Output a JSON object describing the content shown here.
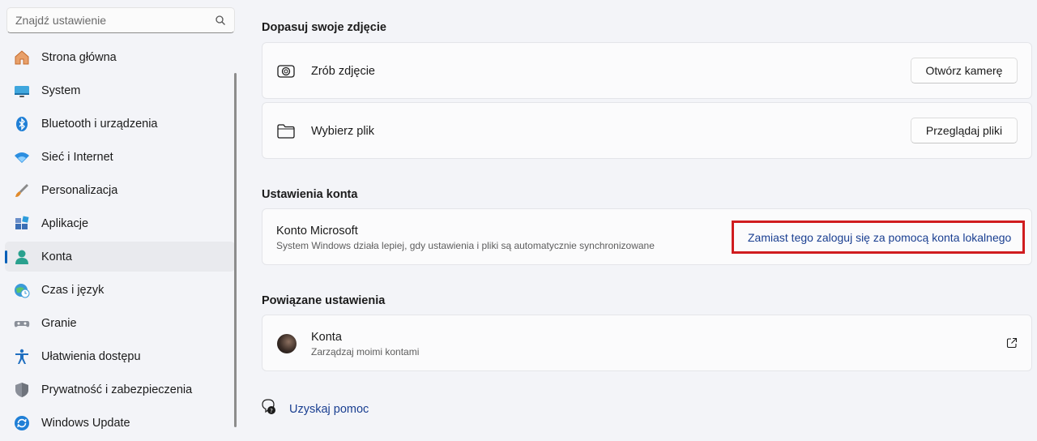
{
  "search": {
    "placeholder": "Znajdź ustawienie"
  },
  "sidebar": {
    "items": [
      {
        "label": "Strona główna",
        "icon": "home-icon"
      },
      {
        "label": "System",
        "icon": "system-monitor-icon"
      },
      {
        "label": "Bluetooth i urządzenia",
        "icon": "bluetooth-icon"
      },
      {
        "label": "Sieć i Internet",
        "icon": "wifi-icon"
      },
      {
        "label": "Personalizacja",
        "icon": "brush-icon"
      },
      {
        "label": "Aplikacje",
        "icon": "apps-icon"
      },
      {
        "label": "Konta",
        "icon": "account-icon",
        "active": true
      },
      {
        "label": "Czas i język",
        "icon": "globe-clock-icon"
      },
      {
        "label": "Granie",
        "icon": "gamepad-icon"
      },
      {
        "label": "Ułatwienia dostępu",
        "icon": "accessibility-icon"
      },
      {
        "label": "Prywatność i zabezpieczenia",
        "icon": "shield-icon"
      },
      {
        "label": "Windows Update",
        "icon": "update-icon"
      }
    ]
  },
  "photo": {
    "title": "Dopasuj swoje zdjęcie",
    "camera_label": "Zrób zdjęcie",
    "camera_button": "Otwórz kamerę",
    "file_label": "Wybierz plik",
    "file_button": "Przeglądaj pliki"
  },
  "account_settings": {
    "title": "Ustawienia konta",
    "account_title": "Konto Microsoft",
    "account_desc": "System Windows działa lepiej, gdy ustawienia i pliki są automatycznie synchronizowane",
    "local_link": "Zamiast tego zaloguj się za pomocą konta lokalnego"
  },
  "related": {
    "title": "Powiązane ustawienia",
    "item_title": "Konta",
    "item_desc": "Zarządzaj moimi kontami"
  },
  "help": {
    "label": "Uzyskaj pomoc"
  },
  "colors": {
    "accent": "#005fb8",
    "link": "#1a3f91",
    "highlight_border": "#d01c1f"
  }
}
